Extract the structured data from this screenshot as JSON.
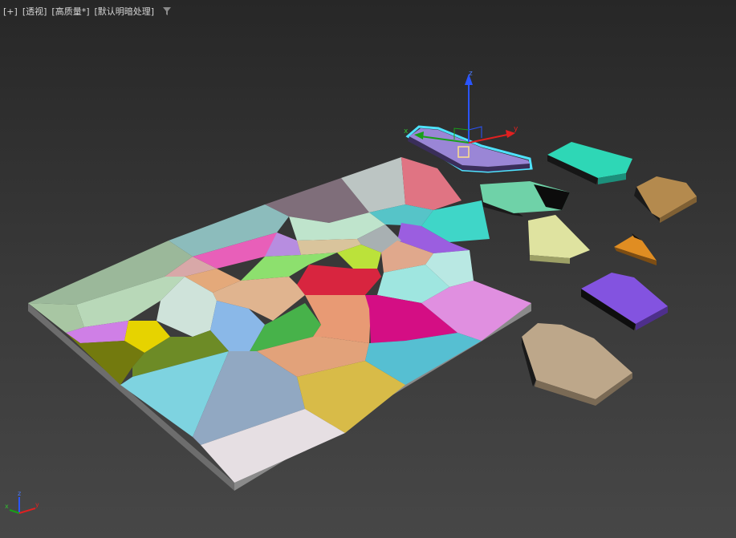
{
  "viewport_label": {
    "plus": "[+]",
    "view": "[透视]",
    "quality": "[高质量*]",
    "shading": "[默认明暗处理]"
  },
  "icons": {
    "filter": "filter-icon",
    "gizmo": "move-gizmo-icon",
    "axis_triad": "axis-triad-icon"
  },
  "axis_letters": {
    "x": "x",
    "y": "y",
    "z": "z"
  },
  "colors": {
    "background_top": "#272727",
    "background_bottom": "#474747",
    "selection_outline": "#4fe3ff",
    "label_text": "#d6d6d6"
  }
}
